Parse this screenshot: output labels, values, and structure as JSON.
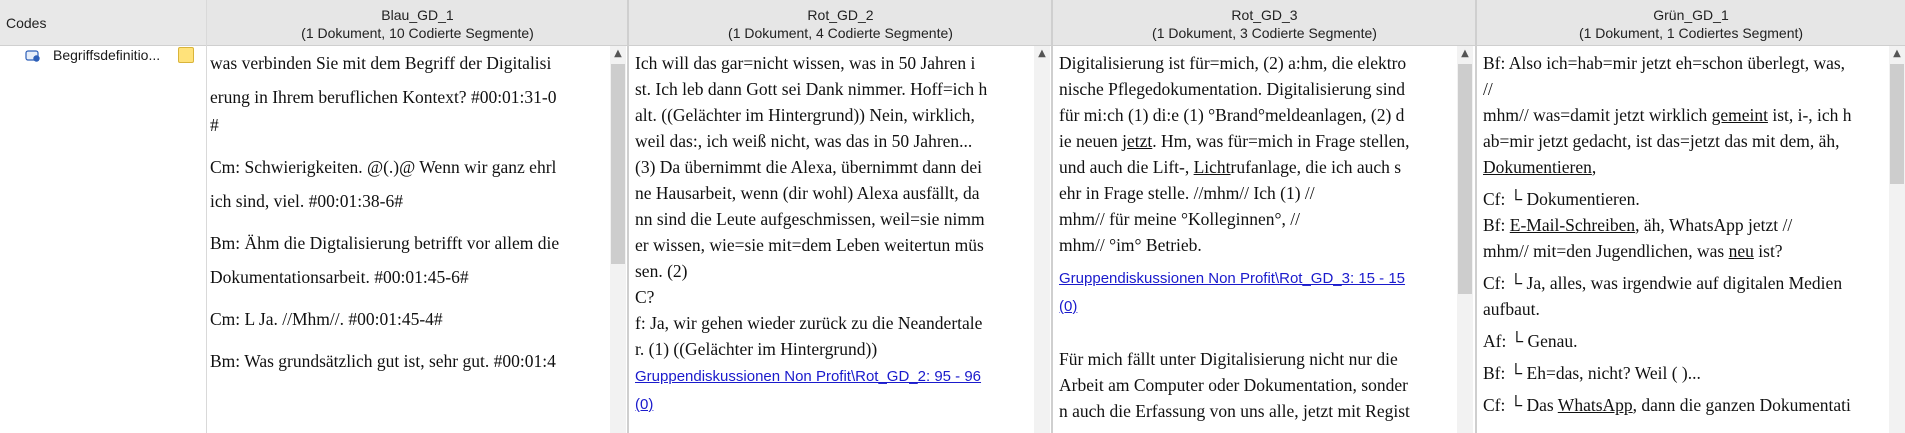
{
  "codes_panel": {
    "header": "Codes",
    "code_label": "Begriffsdefinitio..."
  },
  "columns": [
    {
      "title": "Blau_GD_1",
      "subtitle": "(1 Dokument, 10 Codierte Segmente)",
      "paragraphs": [
        "was verbinden Sie mit dem Begriff der Digitalisi",
        "erung in Ihrem beruflichen Kontext? #00:01:31-0",
        "#",
        "Cm: Schwierigkeiten. @(.)@ Wenn wir ganz ehrl",
        "ich sind, viel. #00:01:38-6#",
        "Bm: Ähm die Digtalisierung betrifft vor allem die",
        " Dokumentationsarbeit. #00:01:45-6#",
        "Cm:  L Ja. //Mhm//. #00:01:45-4#",
        "Bm: Was grundsätzlich gut ist, sehr gut. #00:01:4"
      ]
    },
    {
      "title": "Rot_GD_2",
      "subtitle": "(1 Dokument, 4 Codierte Segmente)",
      "lines": [
        "Ich will das gar=nicht wissen, was in 50 Jahren i",
        "st. Ich leb dann Gott sei Dank nimmer. Hoff=ich h",
        "alt. ((Gelächter im Hintergrund)) Nein, wirklich,",
        "weil das:, ich weiß nicht, was das in 50 Jahren...",
        "(3) Da übernimmt die Alexa, übernimmt dann dei",
        "ne Hausarbeit, wenn (dir wohl) Alexa ausfällt, da",
        "nn sind die Leute aufgeschmissen, weil=sie nimm",
        "er wissen, wie=sie mit=dem Leben weitertun müs",
        "sen. (2)",
        "C?",
        "f: Ja, wir gehen wieder zurück zu die Neandertale",
        "r. (1) ((Gelächter im Hintergrund))"
      ],
      "link_line1": "Gruppendiskussionen Non Profit\\Rot_GD_2: 95 - 96",
      "link_line2": "(0)"
    },
    {
      "title": "Rot_GD_3",
      "subtitle": "(1 Dokument, 3 Codierte Segmente)",
      "lines_top": [
        "Digitalisierung ist für=mich, (2) a:hm, die elektro",
        "nische Pflegedokumentation. Digitalisierung sind",
        "für mi:ch (1) di:e (1) °Brand°meldeanlagen, (2) d",
        "ie neuen jetzt. Hm, was für=mich in Frage stellen,",
        " und auch die Lift-, Lichtrufanlage, die ich auch s",
        "ehr in Frage stelle. //mhm// Ich (1) //",
        "mhm// für meine °Kolleginnen°, //",
        "mhm// °im° Betrieb."
      ],
      "link_line1": "Gruppendiskussionen Non Profit\\Rot_GD_3: 15 - 15",
      "link_line2": "(0)",
      "lines_bottom": [
        "Für mich fällt unter Digitalisierung nicht nur die",
        "Arbeit am Computer oder Dokumentation, sonder",
        "n auch die Erfassung von uns alle, jetzt mit Regist"
      ]
    },
    {
      "title": "Grün_GD_1",
      "subtitle": "(1 Dokument, 1 Codiertes Segment)",
      "lines": [
        "Bf:  Also ich=hab=mir jetzt eh=schon überlegt, was,",
        " //",
        "mhm// was=damit jetzt wirklich gemeint ist, i-, ich h",
        "ab=mir jetzt gedacht, ist das=jetzt das mit dem, äh,",
        "Dokumentieren,",
        "Cf:     └ Dokumentieren.",
        "Bf: E-Mail-Schreiben, äh, WhatsApp jetzt //",
        "mhm// mit=den Jugendlichen, was neu ist?",
        "Cf: └ Ja, alles, was irgendwie auf digitalen Medien",
        "aufbaut.",
        "Af:           └ Genau.",
        "Bf:  └ Eh=das, nicht? Weil (          )...",
        "Cf:    └ Das WhatsApp, dann die ganzen Dokumentati"
      ]
    }
  ]
}
